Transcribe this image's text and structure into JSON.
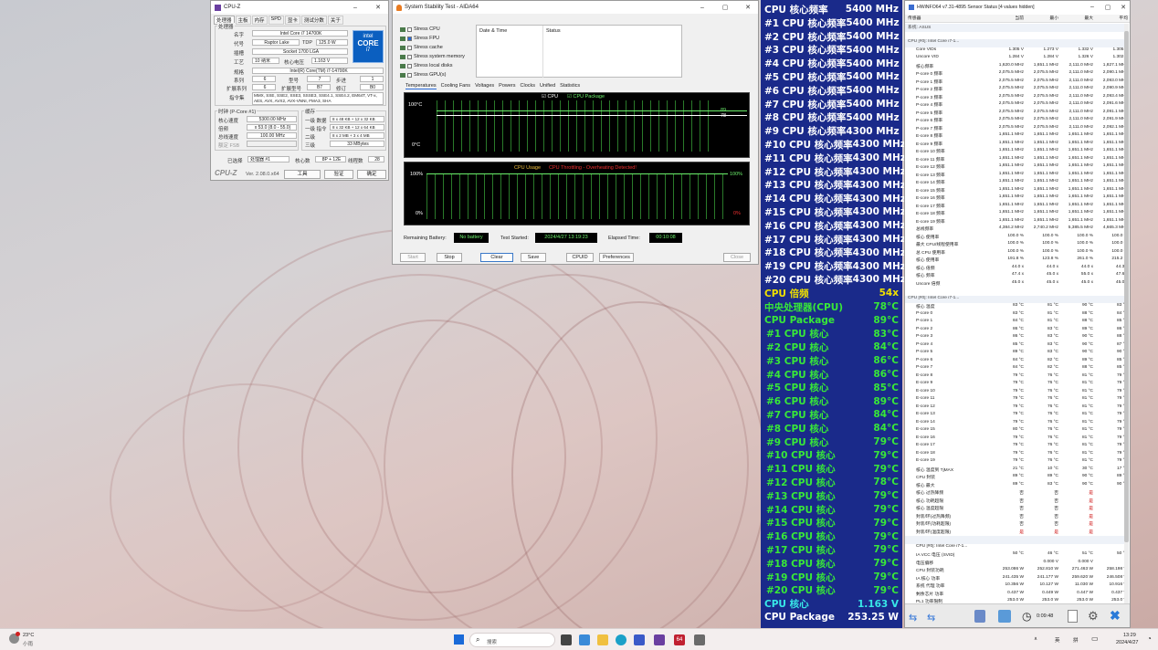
{
  "cpuz": {
    "title": "CPU-Z",
    "tabs": [
      "处理器",
      "主板",
      "内存",
      "SPD",
      "显卡",
      "测试分数",
      "关于"
    ],
    "proc_section": "处理器",
    "labels": {
      "name": "名字",
      "codename": "代号",
      "package": "插槽",
      "tech": "工艺",
      "corevolt": "核心电压",
      "spec": "规格",
      "family": "系列",
      "model": "型号",
      "stepping": "步进",
      "extfamily": "扩展系列",
      "extmodel": "扩展型号",
      "revision": "修订",
      "instr": "指令集",
      "tdp": "TDP"
    },
    "values": {
      "name": "Intel Core i7 14700K",
      "codename": "Raptor Lake",
      "tdp": "125.0 W",
      "package": "Socket 1700 LGA",
      "tech": "10 纳米",
      "corevolt": "1.163 V",
      "spec": "Intel(R) Core(TM) i7-14700K",
      "family": "6",
      "model": "7",
      "stepping": "1",
      "extfamily": "6",
      "extmodel": "B7",
      "revision": "B0",
      "instr": "MMX, SSE, SSE2, SSE3, SSSE3, SSE4.1, SSE4.2, EM64T, VT-x, AES, AVX, AVX2, AVX-VNNI, FMA3, SHA"
    },
    "clock_section": "时钟 (P-Core #1)",
    "cache_section": "缓存",
    "clock_labels": {
      "corespeed": "核心速度",
      "mult": "倍频",
      "bus": "总线速度",
      "fsb": "额定 FSB"
    },
    "clock_values": {
      "corespeed": "5300.00 MHz",
      "mult": "x 53.0 (8.0 - 55.0)",
      "bus": "100.00 MHz",
      "fsb": ""
    },
    "cache_labels": {
      "l1d": "一级 数据",
      "l1i": "一级 指令",
      "l2": "二级",
      "l3": "三级"
    },
    "cache_values": {
      "l1d": "8 x 48 KB + 12 x 32 KB",
      "l1i": "8 x 32 KB + 12 x 64 KB",
      "l2": "8 x 2 MB + 3 x 4 MB",
      "l3": "33 MBytes"
    },
    "footer": {
      "select_label": "已选择",
      "select_value": "处理器 #1",
      "cores_label": "核心数",
      "cores_value": "8P + 12E",
      "threads_label": "线程数",
      "threads_value": "28"
    },
    "brand": "CPU-Z",
    "version": "Ver. 2.08.0.x64",
    "tools": "工具",
    "validate": "验证",
    "ok": "确定",
    "logo_word": "intel",
    "logo_core": "CORE",
    "logo_gen": "i7"
  },
  "aida": {
    "title": "System Stability Test - AIDA64",
    "stress": [
      "Stress CPU",
      "Stress FPU",
      "Stress cache",
      "Stress system memory",
      "Stress local disks",
      "Stress GPU(s)"
    ],
    "stress_checked": [
      false,
      true,
      false,
      false,
      false,
      false
    ],
    "col_date": "Date & Time",
    "col_status": "Status",
    "tabs": [
      "Temperatures",
      "Cooling Fans",
      "Voltages",
      "Powers",
      "Clocks",
      "Unified",
      "Statistics"
    ],
    "graph1": {
      "legend_cpu": "CPU",
      "legend_pkg": "CPU Package",
      "ymax": "100°C",
      "ymin": "0°C",
      "r1": "89",
      "r2": "78"
    },
    "graph2": {
      "title": "CPU Usage",
      "throttle": "CPU Throttling - Overheating Detected!",
      "ymax": "100%",
      "ymin": "0%",
      "rmax": "100%",
      "rmin": "0%"
    },
    "battery_label": "Remaining Battery:",
    "battery_value": "No battery",
    "started_label": "Test Started:",
    "started_value": "2024/4/27 13:19:23",
    "elapsed_label": "Elapsed Time:",
    "elapsed_value": "00:10:08",
    "buttons": [
      "Start",
      "Stop",
      "Clear",
      "Save",
      "CPUID",
      "Preferences",
      "Close"
    ]
  },
  "osd": {
    "rows": [
      {
        "l": "CPU 核心频率",
        "v": "5400 MHz"
      },
      {
        "l": "#1 CPU 核心频率",
        "v": "5400 MHz"
      },
      {
        "l": "#2 CPU 核心频率",
        "v": "5400 MHz"
      },
      {
        "l": "#3 CPU 核心频率",
        "v": "5400 MHz"
      },
      {
        "l": "#4 CPU 核心频率",
        "v": "5400 MHz"
      },
      {
        "l": "#5 CPU 核心频率",
        "v": "5400 MHz"
      },
      {
        "l": "#6 CPU 核心频率",
        "v": "5400 MHz"
      },
      {
        "l": "#7 CPU 核心频率",
        "v": "5400 MHz"
      },
      {
        "l": "#8 CPU 核心频率",
        "v": "5400 MHz"
      },
      {
        "l": "#9 CPU 核心频率",
        "v": "4300 MHz"
      },
      {
        "l": "#10 CPU 核心频率",
        "v": "4300 MHz"
      },
      {
        "l": "#11 CPU 核心频率",
        "v": "4300 MHz"
      },
      {
        "l": "#12 CPU 核心频率",
        "v": "4300 MHz"
      },
      {
        "l": "#13 CPU 核心频率",
        "v": "4300 MHz"
      },
      {
        "l": "#14 CPU 核心频率",
        "v": "4300 MHz"
      },
      {
        "l": "#15 CPU 核心频率",
        "v": "4300 MHz"
      },
      {
        "l": "#16 CPU 核心频率",
        "v": "4300 MHz"
      },
      {
        "l": "#17 CPU 核心频率",
        "v": "4300 MHz"
      },
      {
        "l": "#18 CPU 核心频率",
        "v": "4300 MHz"
      },
      {
        "l": "#19 CPU 核心频率",
        "v": "4300 MHz"
      },
      {
        "l": "#20 CPU 核心频率",
        "v": "4300 MHz"
      },
      {
        "l": "CPU 倍频",
        "v": "54x"
      },
      {
        "l": "中央处理器(CPU)",
        "v": "78°C"
      },
      {
        "l": "CPU Package",
        "v": "89°C"
      },
      {
        "l": "#1 CPU 核心",
        "v": "83°C"
      },
      {
        "l": "#2 CPU 核心",
        "v": "84°C"
      },
      {
        "l": "#3 CPU 核心",
        "v": "86°C"
      },
      {
        "l": "#4 CPU 核心",
        "v": "86°C"
      },
      {
        "l": "#5 CPU 核心",
        "v": "85°C"
      },
      {
        "l": "#6 CPU 核心",
        "v": "89°C"
      },
      {
        "l": "#7 CPU 核心",
        "v": "84°C"
      },
      {
        "l": "#8 CPU 核心",
        "v": "84°C"
      },
      {
        "l": "#9 CPU 核心",
        "v": "79°C"
      },
      {
        "l": "#10 CPU 核心",
        "v": "79°C"
      },
      {
        "l": "#11 CPU 核心",
        "v": "79°C"
      },
      {
        "l": "#12 CPU 核心",
        "v": "78°C"
      },
      {
        "l": "#13 CPU 核心",
        "v": "79°C"
      },
      {
        "l": "#14 CPU 核心",
        "v": "79°C"
      },
      {
        "l": "#15 CPU 核心",
        "v": "79°C"
      },
      {
        "l": "#16 CPU 核心",
        "v": "79°C"
      },
      {
        "l": "#17 CPU 核心",
        "v": "79°C"
      },
      {
        "l": "#18 CPU 核心",
        "v": "79°C"
      },
      {
        "l": "#19 CPU 核心",
        "v": "79°C"
      },
      {
        "l": "#20 CPU 核心",
        "v": "79°C"
      },
      {
        "l": "CPU 核心",
        "v": "1.163 V"
      },
      {
        "l": "CPU Package",
        "v": "253.25 W"
      }
    ],
    "colors": {
      "freq": "#ffffff",
      "mult": "#f0e000",
      "temp": "#38e838",
      "volt": "#38e8e8",
      "power": "#ffffff"
    }
  },
  "hwinfo": {
    "title": "HWiNFO64 v7.31-4895 Sensor Status [4 values hidden]",
    "cols": [
      "传感器",
      "当前",
      "最小",
      "最大",
      "平均"
    ],
    "rows": [
      [
        "系统: ASUS",
        "",
        "",
        "",
        ""
      ],
      [
        "",
        "",
        "",
        "",
        ""
      ],
      [
        "CPU [#0]: Intel Core i7-1...",
        "",
        "",
        "",
        ""
      ],
      [
        "Core VIDs",
        "1.305 V",
        "1.273 V",
        "1.332 V",
        "1.305 V"
      ],
      [
        "Uncore VID",
        "1.284 V",
        "1.284 V",
        "1.326 V",
        "1.302 V"
      ],
      [
        "核心频率",
        "1,620.0 MHz",
        "1,651.1 MHz",
        "2,111.0 MHz",
        "1,827.1 MHz"
      ],
      [
        "P-core 0 频率",
        "2,075.5 MHz",
        "2,075.5 MHz",
        "2,111.0 MHz",
        "2,090.1 MHz"
      ],
      [
        "P-core 1 频率",
        "2,075.5 MHz",
        "2,075.5 MHz",
        "2,111.0 MHz",
        "2,093.0 MHz"
      ],
      [
        "P-core 2 频率",
        "2,075.5 MHz",
        "2,075.5 MHz",
        "2,111.0 MHz",
        "2,090.9 MHz"
      ],
      [
        "P-core 3 频率",
        "2,075.5 MHz",
        "2,075.5 MHz",
        "2,111.0 MHz",
        "2,093.4 MHz"
      ],
      [
        "P-core 4 频率",
        "2,075.5 MHz",
        "2,075.5 MHz",
        "2,111.0 MHz",
        "2,091.6 MHz"
      ],
      [
        "P-core 5 频率",
        "2,075.5 MHz",
        "2,075.5 MHz",
        "2,111.0 MHz",
        "2,091.1 MHz"
      ],
      [
        "P-core 6 频率",
        "2,075.5 MHz",
        "2,075.5 MHz",
        "2,111.0 MHz",
        "2,091.9 MHz"
      ],
      [
        "P-core 7 频率",
        "2,075.5 MHz",
        "2,075.5 MHz",
        "2,111.0 MHz",
        "2,092.1 MHz"
      ],
      [
        "E-core 8 频率",
        "1,651.1 MHz",
        "1,651.1 MHz",
        "1,651.1 MHz",
        "1,651.1 MHz"
      ],
      [
        "E-core 9 频率",
        "1,651.1 MHz",
        "1,651.1 MHz",
        "1,651.1 MHz",
        "1,651.1 MHz"
      ],
      [
        "E-core 10 频率",
        "1,651.1 MHz",
        "1,651.1 MHz",
        "1,651.1 MHz",
        "1,651.1 MHz"
      ],
      [
        "E-core 11 频率",
        "1,651.1 MHz",
        "1,651.1 MHz",
        "1,651.1 MHz",
        "1,651.1 MHz"
      ],
      [
        "E-core 12 频率",
        "1,651.1 MHz",
        "1,651.1 MHz",
        "1,651.1 MHz",
        "1,651.1 MHz"
      ],
      [
        "E-core 13 频率",
        "1,651.1 MHz",
        "1,651.1 MHz",
        "1,651.1 MHz",
        "1,651.1 MHz"
      ],
      [
        "E-core 14 频率",
        "1,651.1 MHz",
        "1,651.1 MHz",
        "1,651.1 MHz",
        "1,651.1 MHz"
      ],
      [
        "E-core 15 频率",
        "1,651.1 MHz",
        "1,651.1 MHz",
        "1,651.1 MHz",
        "1,651.1 MHz"
      ],
      [
        "E-core 16 频率",
        "1,651.1 MHz",
        "1,651.1 MHz",
        "1,651.1 MHz",
        "1,651.1 MHz"
      ],
      [
        "E-core 17 频率",
        "1,651.1 MHz",
        "1,651.1 MHz",
        "1,651.1 MHz",
        "1,651.1 MHz"
      ],
      [
        "E-core 18 频率",
        "1,651.1 MHz",
        "1,651.1 MHz",
        "1,651.1 MHz",
        "1,651.1 MHz"
      ],
      [
        "E-core 19 频率",
        "1,651.1 MHz",
        "1,651.1 MHz",
        "1,651.1 MHz",
        "1,651.1 MHz"
      ],
      [
        "总线频率",
        "4,384.2 MHz",
        "2,740.2 MHz",
        "5,385.5 MHz",
        "4,665.3 MHz"
      ],
      [
        "核心 使用率",
        "100.0 %",
        "100.0 %",
        "100.0 %",
        "100.0 %"
      ],
      [
        "最大 CPU/线程使用率",
        "100.0 %",
        "100.0 %",
        "100.0 %",
        "100.0 %"
      ],
      [
        "总 CPU 使用率",
        "100.0 %",
        "100.0 %",
        "100.0 %",
        "100.0 %"
      ],
      [
        "核心 使用率",
        "191.8 %",
        "123.8 %",
        "261.0 %",
        "215.2 %"
      ],
      [
        "核心 倍频",
        "44.0 x",
        "44.0 x",
        "44.0 x",
        "44.3 x"
      ],
      [
        "核心 频率",
        "47.4 x",
        "45.0 x",
        "55.0 x",
        "47.6 x"
      ],
      [
        "Uncore 倍频",
        "45.0 x",
        "45.0 x",
        "45.0 x",
        "45.0 x"
      ],
      [
        "",
        "",
        "",
        "",
        ""
      ],
      [
        "CPU [#0]: Intel Core i7-1...",
        "",
        "",
        "",
        ""
      ],
      [
        "核心 温度",
        "83 °C",
        "81 °C",
        "90 °C",
        "83 °C"
      ],
      [
        "P-core 0",
        "83 °C",
        "81 °C",
        "88 °C",
        "84 °C"
      ],
      [
        "P-core 1",
        "84 °C",
        "81 °C",
        "88 °C",
        "85 °C"
      ],
      [
        "P-core 2",
        "86 °C",
        "83 °C",
        "89 °C",
        "86 °C"
      ],
      [
        "P-core 3",
        "86 °C",
        "83 °C",
        "90 °C",
        "88 °C"
      ],
      [
        "P-core 4",
        "85 °C",
        "83 °C",
        "90 °C",
        "87 °C"
      ],
      [
        "P-core 5",
        "89 °C",
        "83 °C",
        "90 °C",
        "90 °C"
      ],
      [
        "P-core 6",
        "84 °C",
        "82 °C",
        "89 °C",
        "85 °C"
      ],
      [
        "P-core 7",
        "84 °C",
        "82 °C",
        "88 °C",
        "85 °C"
      ],
      [
        "E-core 8",
        "79 °C",
        "76 °C",
        "81 °C",
        "79 °C"
      ],
      [
        "E-core 9",
        "79 °C",
        "76 °C",
        "81 °C",
        "79 °C"
      ],
      [
        "E-core 10",
        "79 °C",
        "76 °C",
        "81 °C",
        "79 °C"
      ],
      [
        "E-core 11",
        "79 °C",
        "76 °C",
        "81 °C",
        "79 °C"
      ],
      [
        "E-core 12",
        "79 °C",
        "76 °C",
        "81 °C",
        "79 °C"
      ],
      [
        "E-core 13",
        "79 °C",
        "76 °C",
        "81 °C",
        "79 °C"
      ],
      [
        "E-core 14",
        "79 °C",
        "76 °C",
        "81 °C",
        "79 °C"
      ],
      [
        "E-core 15",
        "80 °C",
        "76 °C",
        "81 °C",
        "79 °C"
      ],
      [
        "E-core 16",
        "79 °C",
        "76 °C",
        "81 °C",
        "79 °C"
      ],
      [
        "E-core 17",
        "79 °C",
        "76 °C",
        "81 °C",
        "79 °C"
      ],
      [
        "E-core 18",
        "79 °C",
        "76 °C",
        "81 °C",
        "79 °C"
      ],
      [
        "E-core 19",
        "79 °C",
        "76 °C",
        "81 °C",
        "79 °C"
      ],
      [
        "核心 温度到 TjMAX",
        "21 °C",
        "10 °C",
        "30 °C",
        "17 °C"
      ],
      [
        "CPU 封装",
        "89 °C",
        "89 °C",
        "90 °C",
        "89 °C"
      ],
      [
        "核心 最大",
        "89 °C",
        "83 °C",
        "90 °C",
        "90 °C"
      ],
      [
        "核心 过热降频",
        "否",
        "否",
        "是",
        ""
      ],
      [
        "核心 功耗超限",
        "否",
        "否",
        "是",
        ""
      ],
      [
        "核心 温度超限",
        "否",
        "否",
        "是",
        ""
      ],
      [
        "封装/环(过热降频)",
        "否",
        "否",
        "是",
        ""
      ],
      [
        "封装/环(功耗超限)",
        "否",
        "否",
        "是",
        ""
      ],
      [
        "封装/环(温度超限)",
        "是",
        "是",
        "是",
        ""
      ],
      [
        "",
        "",
        "",
        "",
        ""
      ],
      [
        "CPU [#0]: Intel Core i7-1...",
        "",
        "",
        "",
        ""
      ],
      [
        "IA VCC 电压 (SVID)",
        "50 °C",
        "46 °C",
        "51 °C",
        "50 °C"
      ],
      [
        "电压偏移",
        "",
        "0.000 V",
        "0.000 V",
        ""
      ],
      [
        "CPU 封装功耗",
        "253.086 W",
        "252.810 W",
        "271.463 W",
        "258.198 W"
      ],
      [
        "IA 核心 功率",
        "241.435 W",
        "241.177 W",
        "259.620 W",
        "246.508 W"
      ],
      [
        "系统 代理 功率",
        "10.356 W",
        "10.127 W",
        "11.030 W",
        "10.916 W"
      ],
      [
        "剩余芯片 功率",
        "0.437 W",
        "0.449 W",
        "0.447 W",
        "0.437 W"
      ],
      [
        "PL1 功率限制",
        "253.0 W",
        "253.0 W",
        "253.0 W",
        "253.0 W"
      ]
    ],
    "bottom": {
      "time": "0:09:48"
    }
  },
  "taskbar": {
    "weather_temp": "23°C",
    "weather_text": "小雨",
    "search": "搜索",
    "ime1": "英",
    "ime2": "拼",
    "time": "13:29",
    "date": "2024/4/27"
  }
}
